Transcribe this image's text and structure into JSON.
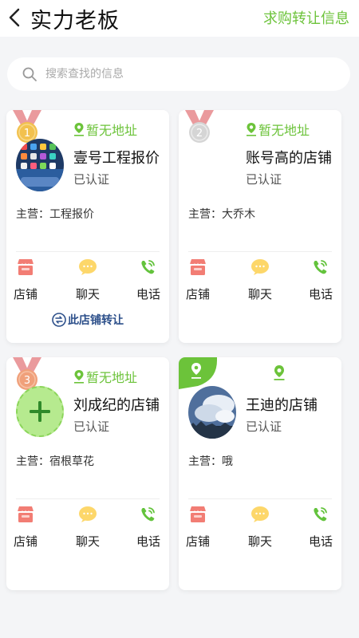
{
  "header": {
    "title": "实力老板",
    "action": "求购转让信息"
  },
  "search": {
    "placeholder": "搜索查找的信息"
  },
  "actions": {
    "shop": "店铺",
    "chat": "聊天",
    "phone": "电话"
  },
  "cards": [
    {
      "rank": "1",
      "address": "暂无地址",
      "name": "壹号工程报价",
      "status": "已认证",
      "main_business": "主营：工程报价",
      "transfer": "此店铺转让"
    },
    {
      "rank": "2",
      "address": "暂无地址",
      "name": "账号高的店铺",
      "status": "已认证",
      "main_business": "主营：大乔木"
    },
    {
      "rank": "3",
      "address": "暂无地址",
      "name": "刘成纪的店铺",
      "status": "已认证",
      "main_business": "主营：宿根草花"
    },
    {
      "name": "王迪的店铺",
      "status": "已认证",
      "main_business": "主营：哦"
    }
  ],
  "colors": {
    "accent": "#6cc33a",
    "shop_icon": "#f27d74",
    "chat_icon": "#fdd76a",
    "phone_icon": "#63c33c",
    "transfer_text": "#2c4f8a",
    "medal_gold": "#f2c14e",
    "medal_silver": "#d5d5d5",
    "medal_bronze": "#f0a07a",
    "ribbon": "#ea9a9d"
  }
}
